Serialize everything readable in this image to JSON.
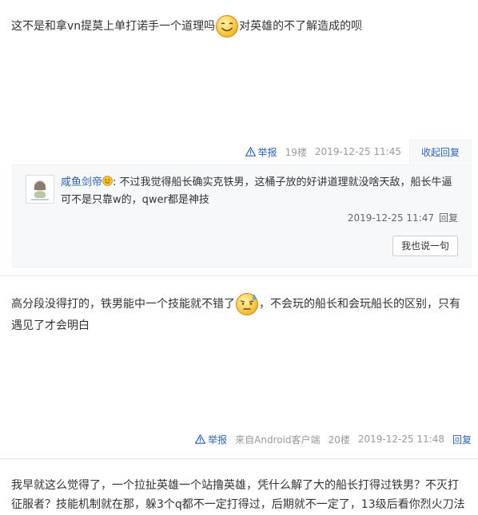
{
  "posts": [
    {
      "text_before": "这不是和拿vn提莫上单打诺手一个道理吗",
      "emoji": "smile-emoji",
      "text_after": "对英雄的不了解造成的呗",
      "report": "举报",
      "floor": "19楼",
      "time": "2019-12-25 11:45",
      "fold_reply": "收起回复",
      "subreply": {
        "user": "咸鱼剑帝",
        "user_emoji": "small-smile-emoji",
        "text": ": 不过我觉得船长确实克铁男，这桶子放的好讲道理就没啥天敌，船长牛逼可不是只靠w的，qwer都是神技",
        "time": "2019-12-25 11:47",
        "reply": "回复",
        "say_button": "我也说一句"
      }
    },
    {
      "text_before": "高分段没得打的，铁男能中一个技能就不错了",
      "emoji": "sweat-emoji",
      "text_after": "，不会玩的船长和会玩船长的区别，只有遇见了才会明白",
      "report": "举报",
      "source": "来自Android客户端",
      "floor": "20楼",
      "time": "2019-12-25 11:48",
      "reply": "回复"
    },
    {
      "text": "我早就这么觉得了，一个拉扯英雄一个站撸英雄，凭什么解了大的船长打得过铁男？不灭打征服者？技能机制就在那，躲3个q都不一定打得过，后期就不一定了，13级后看你烈火刀法"
    }
  ],
  "colors": {
    "link": "#2d64b3",
    "meta": "#999999",
    "subbox_bg": "#f7f8fa"
  }
}
